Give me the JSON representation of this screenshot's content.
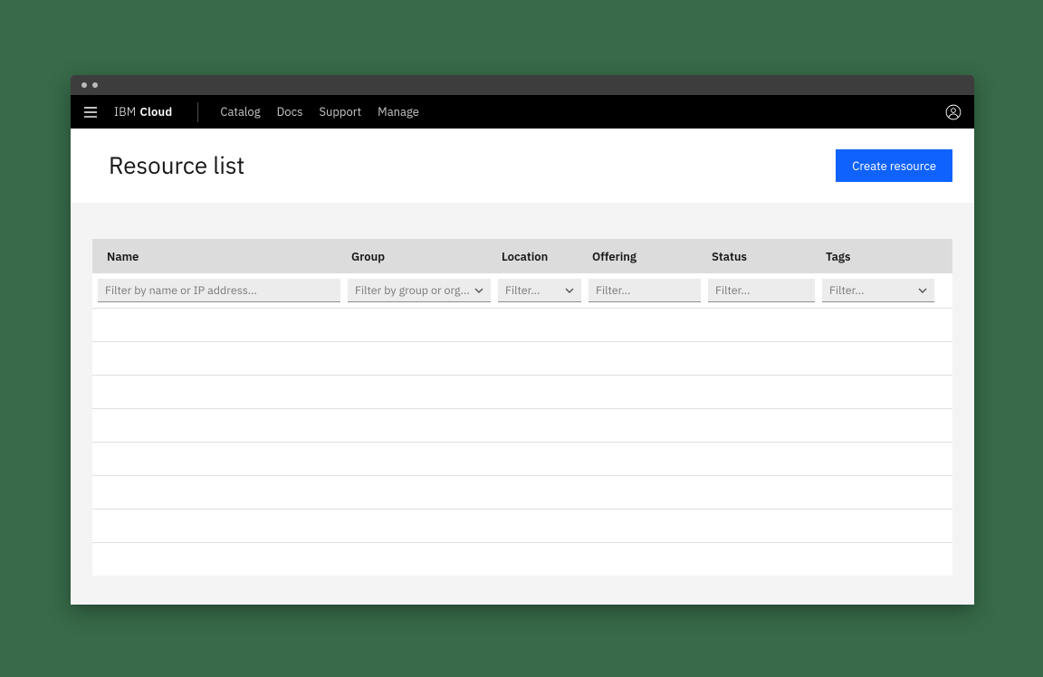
{
  "brand": {
    "prefix": "IBM",
    "suffix": "Cloud"
  },
  "nav": {
    "catalog": "Catalog",
    "docs": "Docs",
    "support": "Support",
    "manage": "Manage"
  },
  "page": {
    "title": "Resource list",
    "create_button": "Create resource"
  },
  "columns": {
    "name": "Name",
    "group": "Group",
    "location": "Location",
    "offering": "Offering",
    "status": "Status",
    "tags": "Tags"
  },
  "filters": {
    "name_placeholder": "Filter by name or IP address...",
    "group_placeholder": "Filter by group or org...",
    "location_placeholder": "Filter...",
    "offering_placeholder": "Filter...",
    "status_placeholder": "Filter...",
    "tags_placeholder": "Filter..."
  },
  "rows": [
    "",
    "",
    "",
    "",
    "",
    "",
    "",
    ""
  ]
}
